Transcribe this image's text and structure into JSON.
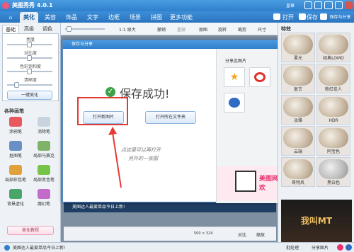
{
  "app": {
    "title": "美图秀秀 4.0.1",
    "right_title": "皇章",
    "open_label": "打开",
    "save_label": "保存",
    "save_share_label": "保存与分享"
  },
  "tabs": [
    "美化",
    "美容",
    "饰品",
    "文字",
    "边框",
    "场景",
    "拼图",
    "更多功能"
  ],
  "toolbar2": {
    "zoom_label": "1:1 原大",
    "actions": [
      "撤销",
      "重做",
      "原图",
      "旋转",
      "裁剪",
      "尺寸"
    ]
  },
  "left": {
    "subtabs": [
      "基础",
      "高级",
      "调色"
    ],
    "sliders": [
      {
        "label": "亮度",
        "value": 0.5
      },
      {
        "label": "对比度",
        "value": 0.5
      },
      {
        "label": "色彩饱和度",
        "value": 0.5
      },
      {
        "label": "清晰度",
        "value": 0.2
      }
    ],
    "one_click_label": "一键美化",
    "brush_section": "各种画笔",
    "tools": [
      "涂鸦笔",
      "消除笔",
      "抠图笔",
      "局部马赛克",
      "局部彩色笔",
      "局部变色笔",
      "背景虚化",
      "魔幻笔"
    ],
    "tutorial_label": "美化教程"
  },
  "right": {
    "title": "特效",
    "effects": [
      "柔光",
      "经典LOMO",
      "复古",
      "粉红佳人",
      "淡雅",
      "HDR",
      "云端",
      "阿宝色",
      "哥特风",
      "黑白色"
    ],
    "ad_label": "我叫MT"
  },
  "dialog": {
    "title": "保存与分享",
    "success_text": "保存成功!",
    "open_image_label": "打开新图片",
    "open_folder_label": "打开所在文件夹",
    "note_line1": "点这里可以再打开",
    "note_line2": "另外的一张图",
    "share_title": "分享此图片",
    "ad_text": "美图网 美欢"
  },
  "promo": {
    "text": "美图达人最爱单品今日上新!",
    "canvas_size": "500 × 324",
    "compare_label": "对比",
    "zoom_label": "缩放"
  },
  "bottom": {
    "promo_text": "美图达人最爱单品今日上新!",
    "batch_label": "批处理",
    "share_label": "分享图片"
  }
}
